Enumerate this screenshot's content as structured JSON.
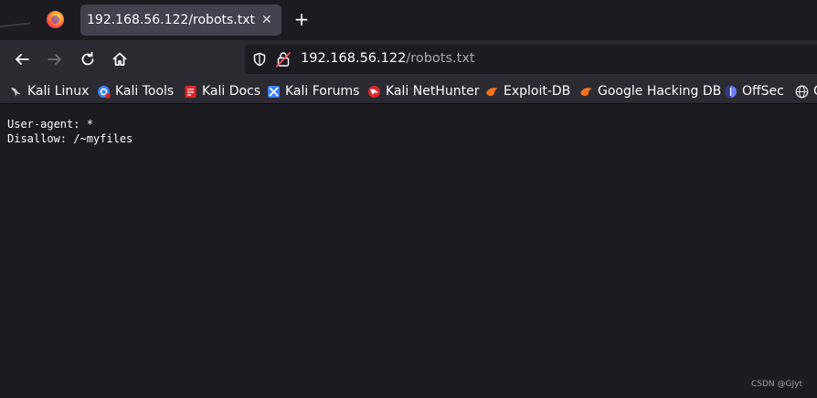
{
  "tab": {
    "title": "192.168.56.122/robots.txt",
    "close_glyph": "✕"
  },
  "new_tab_glyph": "+",
  "address_bar": {
    "host": "192.168.56.122",
    "path": "/robots.txt"
  },
  "bookmarks": [
    {
      "label": "Kali Linux",
      "icon": "kali-dragon-icon",
      "color": "#c9c9d0"
    },
    {
      "label": "Kali Tools",
      "icon": "kali-tools-icon",
      "color": "#3b82f6"
    },
    {
      "label": "Kali Docs",
      "icon": "kali-docs-icon",
      "color": "#dc2626"
    },
    {
      "label": "Kali Forums",
      "icon": "kali-forums-icon",
      "color": "#3b82f6"
    },
    {
      "label": "Kali NetHunter",
      "icon": "kali-nethunter-icon",
      "color": "#dc2626"
    },
    {
      "label": "Exploit-DB",
      "icon": "exploit-db-icon",
      "color": "#f97316"
    },
    {
      "label": "Google Hacking DB",
      "icon": "ghdb-icon",
      "color": "#f97316"
    },
    {
      "label": "OffSec",
      "icon": "offsec-icon",
      "color": "#6b7cff"
    },
    {
      "label": "G",
      "icon": "globe-icon",
      "color": "#e5e5ea"
    }
  ],
  "page": {
    "lines": [
      "User-agent: *",
      "Disallow: /~myfiles"
    ]
  },
  "watermark": "CSDN @GJyt"
}
